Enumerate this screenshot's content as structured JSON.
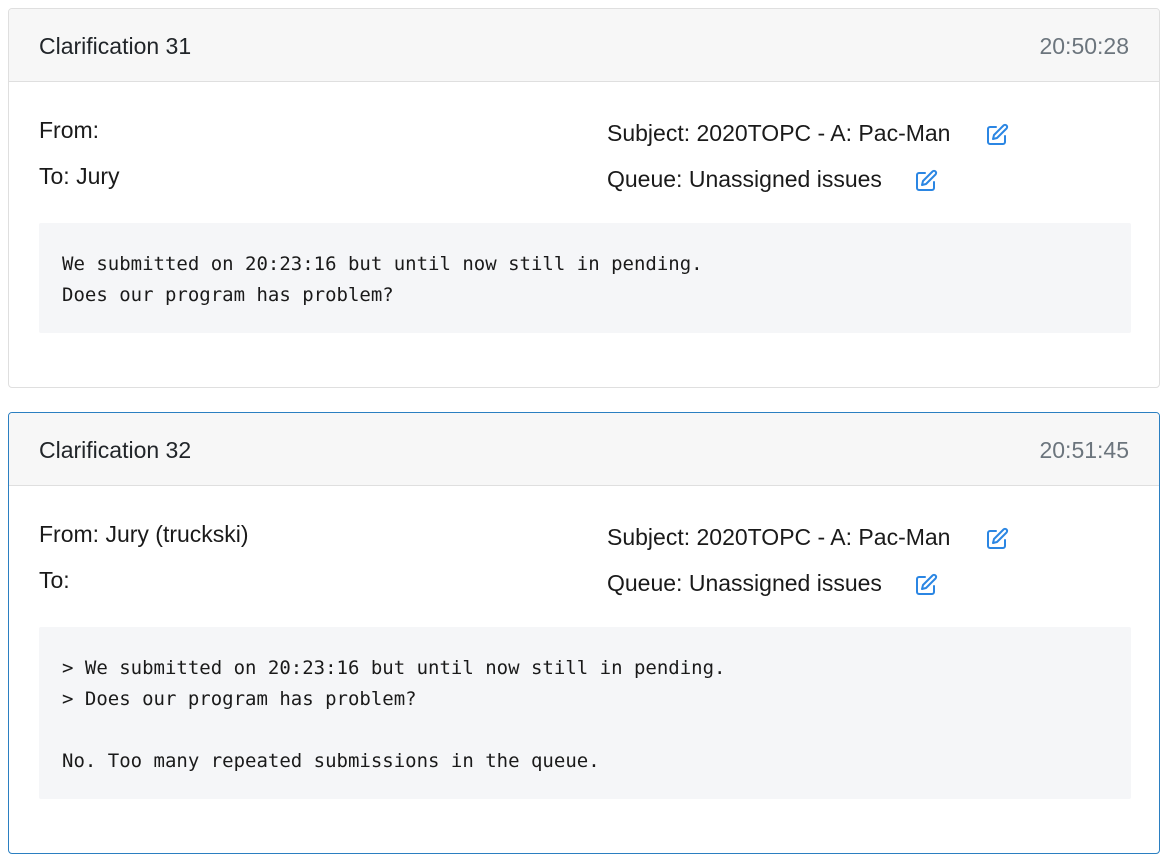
{
  "clarifications": [
    {
      "title": "Clarification 31",
      "time": "20:50:28",
      "from_label": "From:",
      "from_value": "",
      "to_label": "To:",
      "to_value": "Jury",
      "subject_label": "Subject:",
      "subject_value": "2020TOPC - A: Pac-Man",
      "queue_label": "Queue:",
      "queue_value": "Unassigned issues",
      "edit_icon": "pencil-square-icon",
      "message": "We submitted on 20:23:16 but until now still in pending.\nDoes our program has problem?"
    },
    {
      "title": "Clarification 32",
      "time": "20:51:45",
      "from_label": "From:",
      "from_value": "Jury (truckski)",
      "to_label": "To:",
      "to_value": "",
      "subject_label": "Subject:",
      "subject_value": "2020TOPC - A: Pac-Man",
      "queue_label": "Queue:",
      "queue_value": "Unassigned issues",
      "edit_icon": "pencil-square-icon",
      "message": "> We submitted on 20:23:16 but until now still in pending.\n> Does our program has problem?\n\nNo. Too many repeated submissions in the queue."
    }
  ],
  "colors": {
    "header_bg": "#f7f7f7",
    "time_text": "#6c757d",
    "icon_blue": "#2b86e3",
    "active_border": "#2b7fc1",
    "message_bg": "#f5f6f8"
  }
}
